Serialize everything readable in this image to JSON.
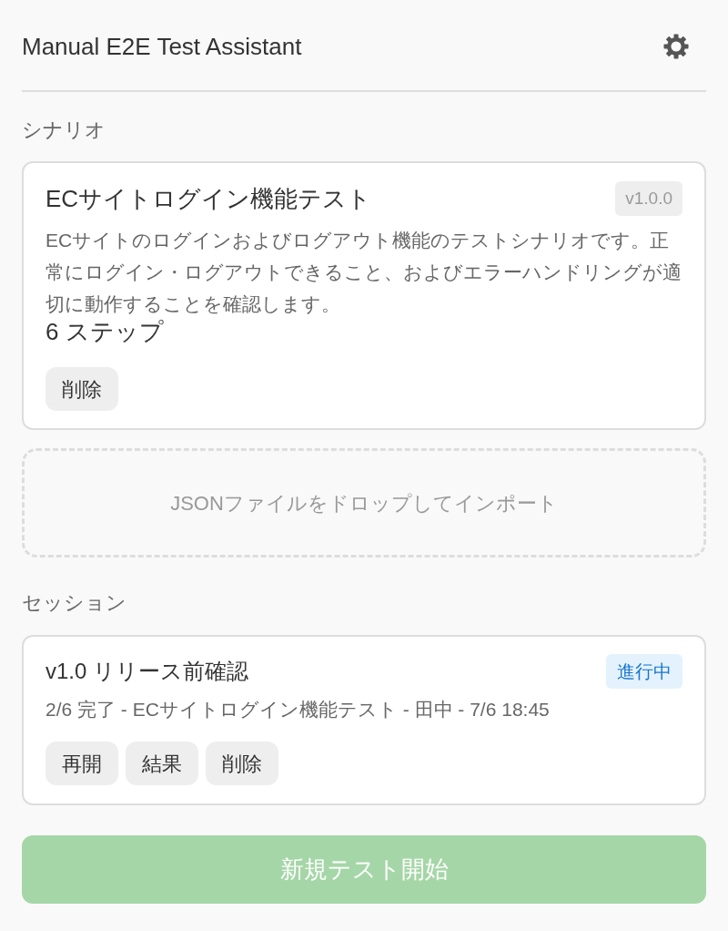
{
  "header": {
    "title": "Manual E2E Test Assistant"
  },
  "scenarios_section": {
    "heading": "シナリオ",
    "scenarios": [
      {
        "title": "ECサイトログイン機能テスト",
        "version": "v1.0.0",
        "description": "ECサイトのログインおよびログアウト機能のテストシナリオです。正常にログイン・ログアウトできること、およびエラーハンドリングが適切に動作することを確認します。",
        "steps": "6 ステップ",
        "buttons": [
          "削除"
        ]
      }
    ],
    "dropzone": {
      "text": "JSONファイルをドロップしてインポート"
    }
  },
  "sessions_section": {
    "heading": "セッション",
    "sessions": [
      {
        "title": "v1.0 リリース前確認",
        "status": {
          "label": "進行中",
          "kind": "in_progress"
        },
        "meta": "2/6 完了 - ECサイトログイン機能テスト - 田中 - 7/6 18:45",
        "buttons": [
          "再開",
          "結果",
          "削除"
        ]
      }
    ]
  },
  "start_button": {
    "label": "新規テスト開始",
    "disabled": true
  }
}
